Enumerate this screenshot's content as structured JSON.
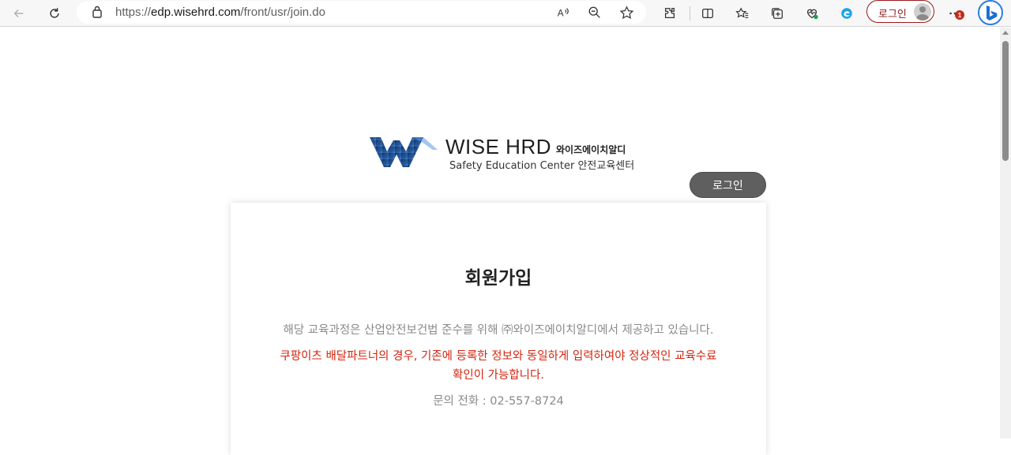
{
  "browser": {
    "url_scheme": "https://",
    "url_host": "edp.wisehrd.com",
    "url_path": "/front/usr/join.do",
    "profile_label": "로그인",
    "notification_count": "1",
    "icons": [
      "back-icon",
      "refresh-icon",
      "lock-icon",
      "read-aloud-icon",
      "zoom-icon",
      "favorite-star-icon",
      "extensions-icon",
      "split-screen-icon",
      "favorites-icon",
      "collections-icon",
      "browser-essentials-icon",
      "edge-icon",
      "profile-avatar-icon",
      "more-icon",
      "bing-icon"
    ]
  },
  "logo": {
    "brand": "WISE HRD",
    "brand_ko": "와이즈에이치알디",
    "tagline": "Safety Education Center 안전교육센터",
    "colors": [
      "#1f4e8c",
      "#3f7fd1",
      "#0f2f5c"
    ]
  },
  "header": {
    "login_button": "로그인"
  },
  "card": {
    "title": "회원가입",
    "description": "해당 교육과정은 산업안전보건법 준수를 위해 ㈜와이즈에이치알디에서 제공하고 있습니다.",
    "warning_line1": "쿠팡이츠 배달파트너의 경우, 기존에 등록한 정보와 동일하게 입력하여야 정상적인 교육수료",
    "warning_line2": "확인이 가능합니다.",
    "phone": "문의 전화 : 02-557-8724"
  },
  "colors": {
    "warning": "#d4250f",
    "login_button_bg": "#5f5f5f",
    "profile_border": "#9b1b1b"
  }
}
